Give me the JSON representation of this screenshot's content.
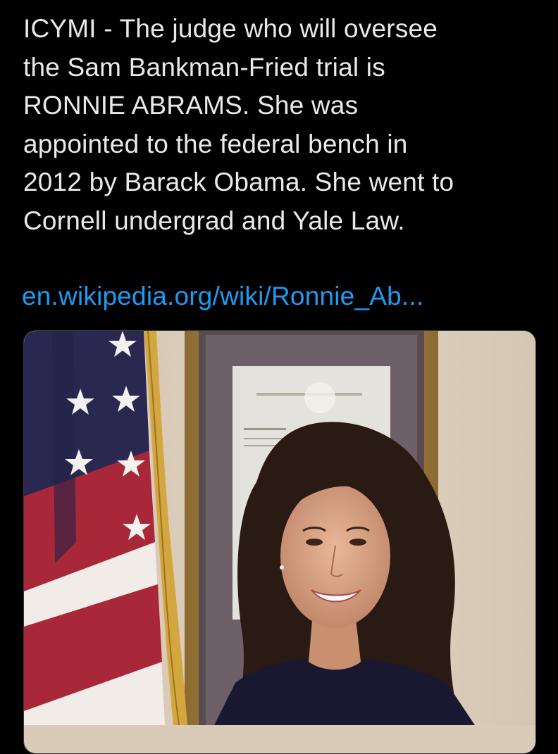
{
  "tweet": {
    "text_lines": [
      "ICYMI - The judge who will oversee",
      "the Sam Bankman-Fried trial is",
      "RONNIE ABRAMS. She was",
      "appointed to the federal bench in",
      "2012 by Barack Obama. She went to",
      "Cornell undergrad and Yale Law."
    ],
    "link_text": "en.wikipedia.org/wiki/Ronnie_Ab..."
  },
  "media": {
    "subject": "portrait-photo",
    "colors": {
      "wall": "#d9cbb8",
      "frame_gold": "#a88a4a",
      "flag_blue": "#2a2850",
      "flag_red": "#a8283a",
      "fringe": "#d4a640",
      "hair": "#2a1a14",
      "skin": "#d9a487",
      "top": "#1a1830"
    }
  },
  "colors": {
    "background": "#000000",
    "text": "#e7e9ea",
    "link": "#1d9bf0"
  }
}
